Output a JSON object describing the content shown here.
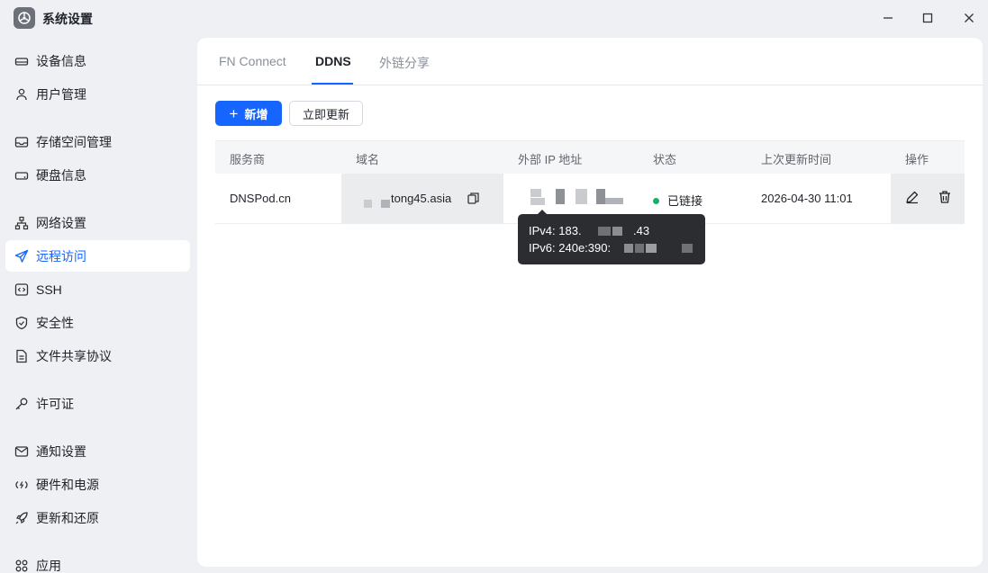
{
  "window": {
    "title": "系统设置",
    "controls": [
      "minimize-icon",
      "maximize-icon",
      "close-icon"
    ]
  },
  "sidebar": {
    "items": [
      {
        "label": "设备信息",
        "icon": "drive-icon"
      },
      {
        "label": "用户管理",
        "icon": "user-icon"
      },
      {
        "label": "存储空间管理",
        "icon": "storage-icon"
      },
      {
        "label": "硬盘信息",
        "icon": "disk-icon"
      },
      {
        "label": "网络设置",
        "icon": "network-icon"
      },
      {
        "label": "远程访问",
        "icon": "send-icon",
        "active": true
      },
      {
        "label": "SSH",
        "icon": "code-icon"
      },
      {
        "label": "安全性",
        "icon": "shield-icon"
      },
      {
        "label": "文件共享协议",
        "icon": "file-icon"
      },
      {
        "label": "许可证",
        "icon": "key-icon"
      },
      {
        "label": "通知设置",
        "icon": "mail-icon"
      },
      {
        "label": "硬件和电源",
        "icon": "power-icon"
      },
      {
        "label": "更新和还原",
        "icon": "rocket-icon"
      },
      {
        "label": "应用",
        "icon": "apps-icon"
      }
    ]
  },
  "tabs": [
    {
      "label": "FN Connect"
    },
    {
      "label": "DDNS",
      "active": true
    },
    {
      "label": "外链分享"
    }
  ],
  "toolbar": {
    "add_icon": "+",
    "add_label": "新增",
    "refresh_label": "立即更新"
  },
  "table": {
    "headers": [
      "服务商",
      "域名",
      "外部 IP 地址",
      "状态",
      "上次更新时间",
      "操作"
    ],
    "rows": [
      {
        "provider": "DNSPod.cn",
        "domain": "tong45.asia",
        "status": "已链接",
        "updated": "2026-04-30 11:01",
        "actions": [
          "edit-icon",
          "delete-icon"
        ]
      }
    ]
  },
  "tooltip": {
    "ipv4_label": "IPv4:",
    "ipv4_prefix": "183.",
    "ipv4_suffix": ".43",
    "ipv6_label": "IPv6:",
    "ipv6_prefix": "240e:390:"
  },
  "colors": {
    "accent": "#1665ff",
    "status_ok": "#13b26b",
    "tooltip_bg": "#2b2d31",
    "window_bg": "#eef0f4"
  }
}
